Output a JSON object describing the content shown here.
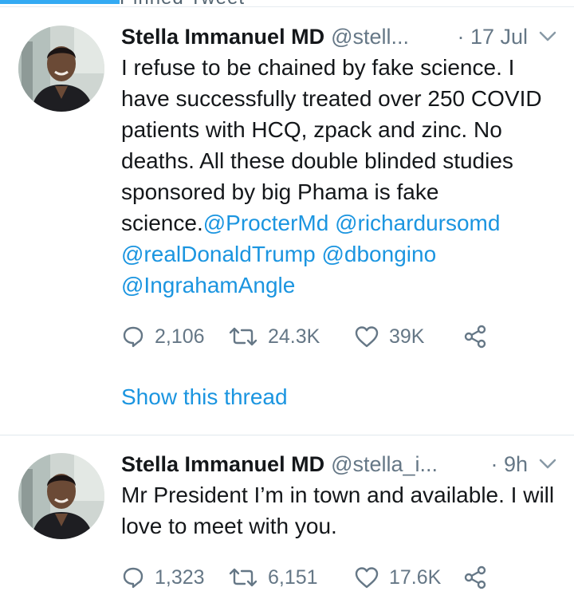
{
  "header": {
    "pinned_label": "Pinned Tweet"
  },
  "tweets": [
    {
      "author_name": "Stella Immanuel MD",
      "handle": "@stell...",
      "time": "· 17 Jul",
      "text_plain": "I refuse to be chained by fake science. I have successfully treated over 250 COVID patients with HCQ, zpack and zinc. No deaths. All these double blinded studies sponsored by big Phama is fake science.",
      "mentions": [
        "@ProcterMd",
        "@richardursomd",
        "@realDonaldTrump",
        "@dbongino",
        "@IngrahamAngle"
      ],
      "replies": "2,106",
      "retweets": "24.3K",
      "likes": "39K",
      "show_thread": "Show this thread"
    },
    {
      "author_name": "Stella Immanuel MD",
      "handle": "@stella_i...",
      "time": "· 9h",
      "text_plain": "Mr President I’m in town and available. I will love to meet with you.",
      "replies": "1,323",
      "retweets": "6,151",
      "likes": "17.6K"
    }
  ],
  "colors": {
    "link": "#1b95e0",
    "muted": "#657786",
    "text": "#14171a",
    "divider": "#e1e8ed"
  },
  "icons": {
    "reply": "reply-icon",
    "retweet": "retweet-icon",
    "like": "like-icon",
    "share": "share-icon",
    "caret": "chevron-down-icon"
  }
}
